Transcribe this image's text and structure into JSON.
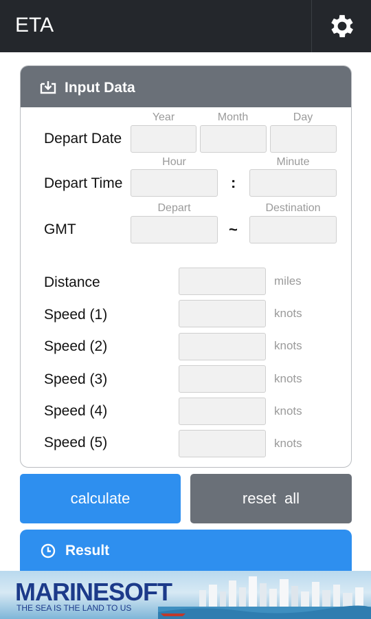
{
  "appbar": {
    "title": "ETA",
    "settings_icon": "gear-icon"
  },
  "input_card": {
    "title": "Input Data",
    "icon": "download-tray-icon",
    "date": {
      "label": "Depart Date",
      "year": "Year",
      "month": "Month",
      "day": "Day"
    },
    "time": {
      "label": "Depart Time",
      "hour": "Hour",
      "minute": "Minute",
      "separator": ":"
    },
    "gmt": {
      "label": "GMT",
      "depart": "Depart",
      "destination": "Destination",
      "separator": "~"
    },
    "distance": {
      "label": "Distance",
      "unit": "miles"
    },
    "speeds": [
      {
        "label": "Speed (1)",
        "unit": "knots"
      },
      {
        "label": "Speed (2)",
        "unit": "knots"
      },
      {
        "label": "Speed (3)",
        "unit": "knots"
      },
      {
        "label": "Speed (4)",
        "unit": "knots"
      },
      {
        "label": "Speed (5)",
        "unit": "knots"
      }
    ]
  },
  "buttons": {
    "calculate": "calculate",
    "reset": "reset  all"
  },
  "result": {
    "title": "Result",
    "icon": "clock-icon"
  },
  "banner": {
    "logo": "MARINESOFT",
    "tagline": "THE SEA IS THE LAND TO US"
  },
  "colors": {
    "appbar": "#24272c",
    "header_gray": "#6a7078",
    "accent_blue": "#2e8fef",
    "brand_navy": "#1c3a8a"
  }
}
